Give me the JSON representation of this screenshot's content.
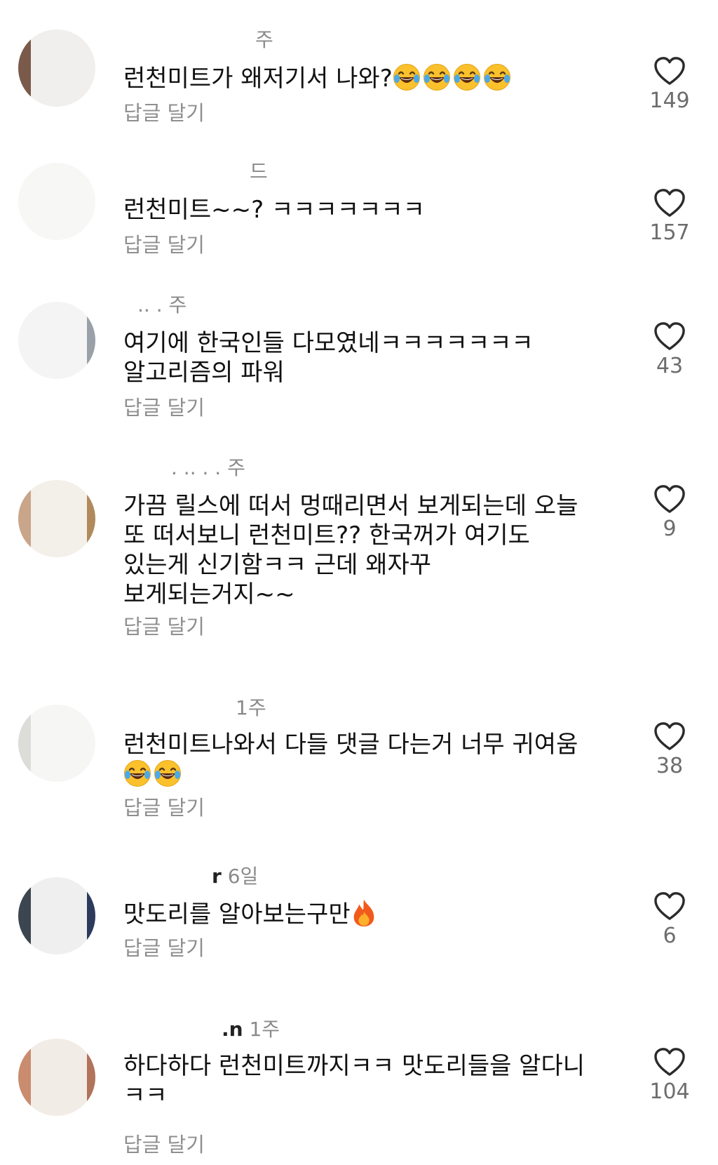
{
  "comments": [
    {
      "username": "주",
      "text": "런천미트가 왜저기서 나와?",
      "emoji_after_text": [
        "face-with-tears-of-joy-icon",
        "face-with-tears-of-joy-icon",
        "face-with-tears-of-joy-icon",
        "face-with-tears-of-joy-icon"
      ],
      "reply_label": "답글 달기",
      "likes": "149"
    },
    {
      "username": "드",
      "text": "런천미트~~? ㅋㅋㅋㅋㅋㅋㅋ",
      "reply_label": "답글 달기",
      "likes": "157"
    },
    {
      "username": "..  .  주",
      "text": "여기에 한국인들 다모였네ㅋㅋㅋㅋㅋㅋㅋ\n알고리즘의 파워",
      "reply_label": "답글 달기",
      "likes": "43"
    },
    {
      "username": ". .. . . 주",
      "text": "가끔 릴스에 떠서 멍때리면서 보게되는데 오늘\n또 떠서보니 런천미트?? 한국꺼가 여기도\n있는게 신기함ㅋㅋ 근데 왜자꾸\n보게되는거지~~",
      "reply_label": "답글 달기",
      "likes": "9"
    },
    {
      "username": "1주",
      "text": "런천미트나와서 다들 댓글 다는거 너무 귀여움",
      "emoji_below_text": [
        "face-with-tears-of-joy-icon",
        "face-with-tears-of-joy-icon"
      ],
      "reply_label": "답글 달기",
      "likes": "38"
    },
    {
      "username_partial": "r",
      "username": "6일",
      "text": "맛도리를 알아보는구만",
      "emoji_after_text": [
        "fire-icon"
      ],
      "reply_label": "답글 달기",
      "likes": "6"
    },
    {
      "username_partial": ".n",
      "username": "1주",
      "text": "하다하다 런천미트까지ㅋㅋ 맛도리들을 알다니\nㅋㅋ",
      "reply_label": "답글 달기",
      "likes": "104"
    }
  ],
  "icons": {
    "like": "heart-outline-icon",
    "laugh": "face-with-tears-of-joy-icon",
    "fire": "fire-icon"
  },
  "colors": {
    "text": "#111111",
    "secondary": "#8f8f8f",
    "count": "#6d6d6d",
    "background": "#ffffff",
    "emoji_yellow": "#fbc12d",
    "fire_orange": "#f25a1d"
  }
}
